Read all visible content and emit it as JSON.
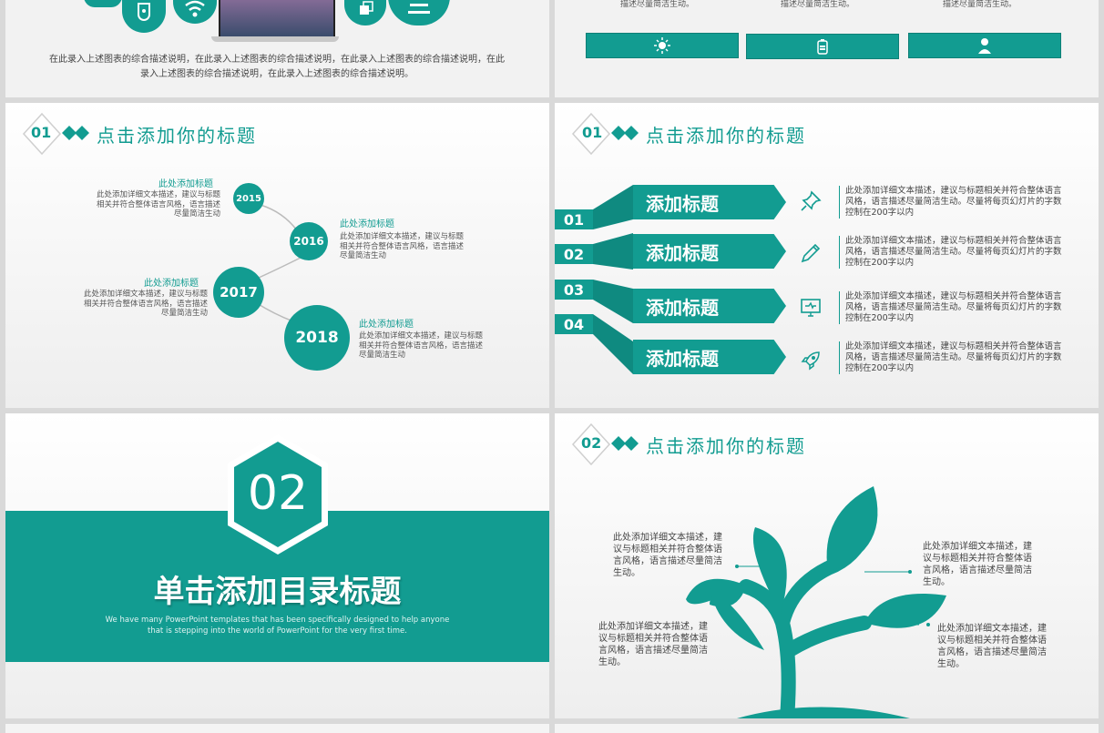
{
  "colors": {
    "accent": "#129c91",
    "bg": "#f4f4f4"
  },
  "slide1": {
    "caption": "在此录入上述图表的综合描述说明，在此录入上述图表的综合描述说明，在此录入上述图表的综合描述说明，在此录入上述图表的综合描述说明，在此录入上述图表的综合描述说明。"
  },
  "slide2": {
    "texts": [
      "描述尽量简洁生动。",
      "描述尽量简洁生动。",
      "描述尽量简洁生动。"
    ],
    "icons": [
      "sun-icon",
      "battery-icon",
      "person-icon"
    ]
  },
  "slide3": {
    "num": "01",
    "title": "点击添加你的标题",
    "items": [
      {
        "year": "2015",
        "title": "此处添加标题",
        "text": "此处添加详细文本描述，建议与标题相关并符合整体语言风格，语言描述尽量简洁生动"
      },
      {
        "year": "2016",
        "title": "此处添加标题",
        "text": "此处添加详细文本描述，建议与标题相关并符合整体语言风格，语言描述尽量简洁生动"
      },
      {
        "year": "2017",
        "title": "此处添加标题",
        "text": "此处添加详细文本描述，建议与标题相关并符合整体语言风格，语言描述尽量简洁生动"
      },
      {
        "year": "2018",
        "title": "此处添加标题",
        "text": "此处添加详细文本描述，建议与标题相关并符合整体语言风格，语言描述尽量简洁生动"
      }
    ]
  },
  "slide4": {
    "num": "01",
    "title": "点击添加你的标题",
    "rows": [
      {
        "num": "01",
        "label": "添加标题",
        "icon": "pin-icon",
        "text": "此处添加详细文本描述，建议与标题相关并符合整体语言风格，语言描述尽量简洁生动。尽量将每页幻灯片的字数控制在200字以内"
      },
      {
        "num": "02",
        "label": "添加标题",
        "icon": "pencil-icon",
        "text": "此处添加详细文本描述，建议与标题相关并符合整体语言风格，语言描述尽量简洁生动。尽量将每页幻灯片的字数控制在200字以内"
      },
      {
        "num": "03",
        "label": "添加标题",
        "icon": "monitor-icon",
        "text": "此处添加详细文本描述，建议与标题相关并符合整体语言风格，语言描述尽量简洁生动。尽量将每页幻灯片的字数控制在200字以内"
      },
      {
        "num": "04",
        "label": "添加标题",
        "icon": "rocket-icon",
        "text": "此处添加详细文本描述，建议与标题相关并符合整体语言风格，语言描述尽量简洁生动。尽量将每页幻灯片的字数控制在200字以内"
      }
    ]
  },
  "slide5": {
    "num": "02",
    "title": "单击添加目录标题",
    "subtitle_line1": "We have many PowerPoint templates that has been specifically designed to help anyone",
    "subtitle_line2": "that is stepping into the world of PowerPoint for the very first time."
  },
  "slide6": {
    "num": "02",
    "title": "点击添加你的标题",
    "texts": [
      "此处添加详细文本描述，建议与标题相关并符合整体语言风格，语言描述尽量简洁生动。",
      "此处添加详细文本描述，建议与标题相关并符合整体语言风格，语言描述尽量简洁生动。",
      "此处添加详细文本描述，建议与标题相关并符合整体语言风格，语言描述尽量简洁生动。",
      "此处添加详细文本描述，建议与标题相关并符合整体语言风格，语言描述尽量简洁生动。"
    ]
  }
}
